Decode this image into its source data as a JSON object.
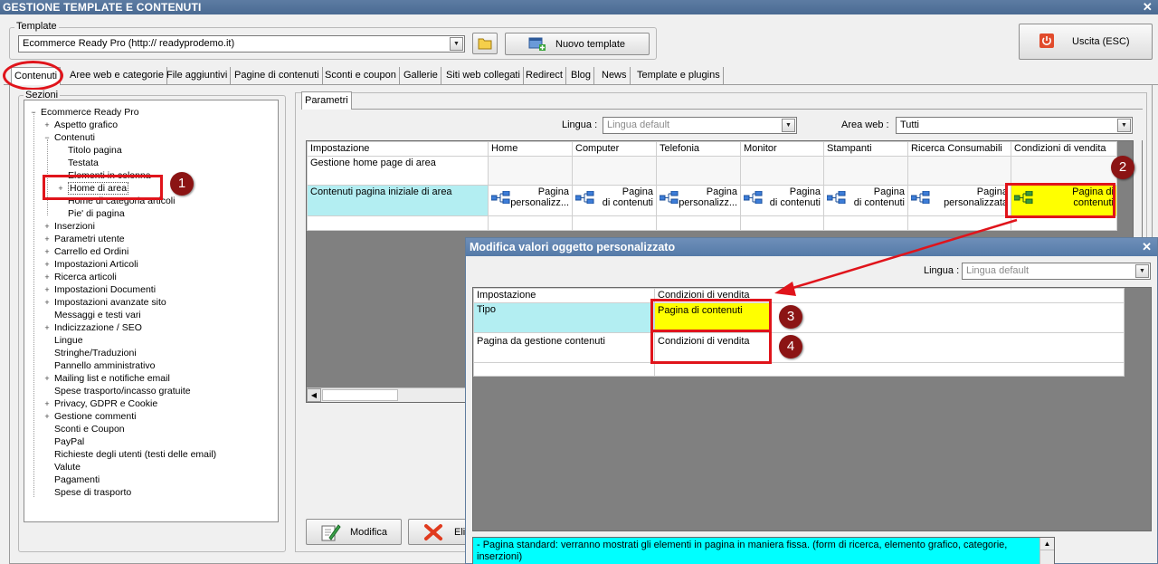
{
  "window": {
    "title": "GESTIONE TEMPLATE E CONTENUTI"
  },
  "template": {
    "group_label": "Template",
    "selected": "Ecommerce Ready Pro (http://        readyprodemo.it)",
    "new_button": "Nuovo template",
    "exit_button": "Uscita (ESC)"
  },
  "tabs": [
    "Contenuti",
    "Aree web e categorie",
    "File aggiuntivi",
    "Pagine di contenuti",
    "Sconti e coupon",
    "Gallerie",
    "Siti web collegati",
    "Redirect",
    "Blog",
    "News",
    "Template e plugins"
  ],
  "sections": {
    "label": "Sezioni",
    "root": "Ecommerce Ready Pro",
    "items": [
      "Aspetto grafico",
      "Contenuti",
      "Titolo pagina",
      "Testata",
      "Elementi in colonna",
      "Home di area",
      "Home di categoria articoli",
      "Pie' di pagina",
      "Inserzioni",
      "Parametri utente",
      "Carrello ed Ordini",
      "Impostazioni Articoli",
      "Ricerca articoli",
      "Impostazioni Documenti",
      "Impostazioni avanzate sito",
      "Messaggi e testi vari",
      "Indicizzazione / SEO",
      "Lingue",
      "Stringhe/Traduzioni",
      "Pannello amministrativo",
      "Mailing list e notifiche email",
      "Spese trasporto/incasso gratuite",
      "Privacy, GDPR e Cookie",
      "Gestione commenti",
      "Sconti e Coupon",
      "PayPal",
      "Richieste degli utenti (testi delle email)",
      "Valute",
      "Pagamenti",
      "Spese di trasporto"
    ]
  },
  "params": {
    "tab": "Parametri",
    "lingua_label": "Lingua :",
    "lingua_value": "Lingua default",
    "area_label": "Area web :",
    "area_value": "Tutti",
    "columns": [
      "Impostazione",
      "Home",
      "Computer",
      "Telefonia",
      "Monitor",
      "Stampanti",
      "Ricerca Consumabili",
      "Condizioni di vendita"
    ],
    "row1": "Gestione home page di area",
    "row2": {
      "label": "Contenuti pagina iniziale di area",
      "cells": [
        [
          "Pagina",
          "personalizz..."
        ],
        [
          "Pagina",
          "di contenuti"
        ],
        [
          "Pagina",
          "personalizz..."
        ],
        [
          "Pagina",
          "di contenuti"
        ],
        [
          "Pagina",
          "di contenuti"
        ],
        [
          "Pagina",
          "personalizzata"
        ],
        [
          "Pagina di",
          "contenuti"
        ]
      ]
    }
  },
  "buttons": {
    "modify": "Modifica",
    "delete": "Eli"
  },
  "dialog": {
    "title": "Modifica valori oggetto personalizzato",
    "lingua_label": "Lingua :",
    "lingua_value": "Lingua default",
    "col1": "Impostazione",
    "col2": "Condizioni di vendita",
    "rows": [
      {
        "label": "Tipo",
        "value": "Pagina di contenuti"
      },
      {
        "label": "Pagina da gestione contenuti",
        "value": "Condizioni di vendita"
      }
    ],
    "description": "- Pagina standard: verranno mostrati gli elementi in pagina in maniera fissa. (form di ricerca, elemento grafico, categorie, inserzioni)"
  },
  "badges": [
    "1",
    "2",
    "3",
    "4"
  ],
  "colors": {
    "accent_red": "#e0141b",
    "badge": "#8b1414",
    "highlight_yellow": "#ffff00",
    "highlight_cyan": "#b3eef2"
  }
}
